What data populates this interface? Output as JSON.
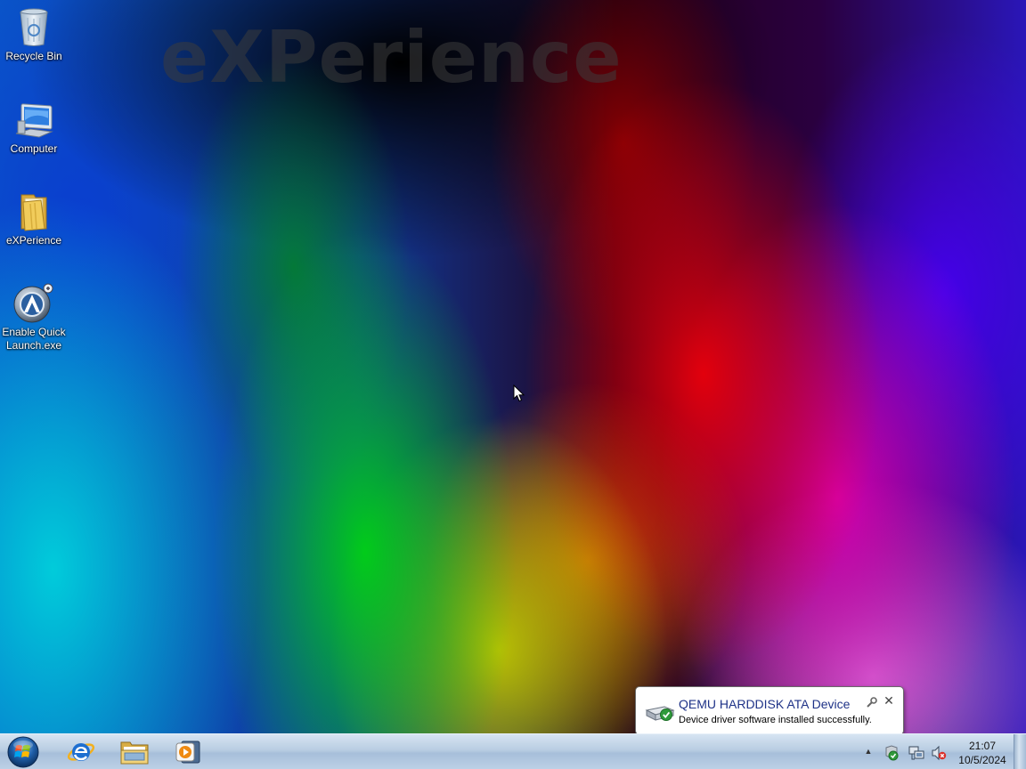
{
  "wallpaper": {
    "logo_text": "eXPerience"
  },
  "desktop": {
    "icons": [
      {
        "label": "Recycle Bin",
        "icon": "recycle-bin-icon"
      },
      {
        "label": "Computer",
        "icon": "computer-icon"
      },
      {
        "label": "eXPerience",
        "icon": "folder-icon"
      },
      {
        "label": "Enable Quick\nLaunch.exe",
        "icon": "quick-launch-app-icon"
      }
    ]
  },
  "notification": {
    "title": "QEMU HARDDISK ATA Device",
    "body": "Device driver software installed successfully.",
    "icon": "hard-drive-check-icon",
    "close_glyph": "✕"
  },
  "taskbar": {
    "start_icon": "windows-start-orb-icon",
    "pinned": [
      {
        "name": "internet-explorer",
        "icon": "internet-explorer-icon"
      },
      {
        "name": "windows-explorer",
        "icon": "windows-explorer-folder-icon"
      },
      {
        "name": "windows-media-player",
        "icon": "media-player-icon"
      }
    ],
    "tray": {
      "overflow_glyph": "▲",
      "icons": [
        "device-installed-icon",
        "network-icon",
        "volume-muted-icon"
      ]
    },
    "clock": {
      "time": "21:07",
      "date": "10/5/2024"
    }
  },
  "colors": {
    "taskbar_top": "#d6e4f2",
    "balloon_title": "#1e3287",
    "desktop_label": "#ffffff"
  }
}
